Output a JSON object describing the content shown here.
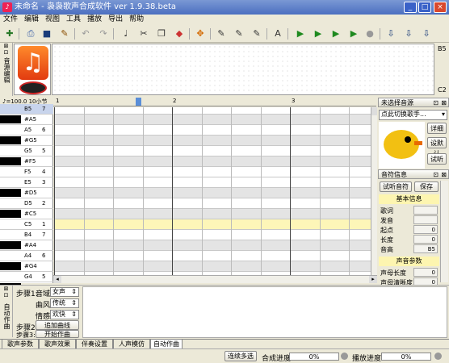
{
  "window": {
    "title": "未命名 - 袅袅歌声合成软件 ver 1.9.38.beta",
    "minimize": "_",
    "maximize": "□",
    "close": "×"
  },
  "menu": [
    "文件",
    "编辑",
    "视图",
    "工具",
    "播放",
    "导出",
    "帮助"
  ],
  "toolbar": {
    "icons": [
      "new-icon",
      "print-icon",
      "save-icon",
      "edit-icon",
      "undo-icon",
      "redo-icon",
      "note-icon",
      "cut-icon",
      "copy-icon",
      "eraser-icon",
      "move-icon",
      "pen-icon",
      "pen2-icon",
      "pen3-icon",
      "text-icon",
      "play-icon",
      "play2-icon",
      "play3-icon",
      "play4-icon",
      "stop-icon",
      "export-icon",
      "export2-icon",
      "export3-icon"
    ]
  },
  "singer_area": {
    "side_label": "音源编辑",
    "right_top": "B5",
    "right_bottom": "C2"
  },
  "ruler": {
    "header": "♪=100.0 10小节",
    "marks": [
      "1",
      "2",
      "3"
    ]
  },
  "piano_keys": [
    {
      "name": "B5",
      "num": "7",
      "black": false,
      "selected": true
    },
    {
      "name": "#A5",
      "num": "",
      "black": true
    },
    {
      "name": "A5",
      "num": "6",
      "black": false
    },
    {
      "name": "#G5",
      "num": "",
      "black": true
    },
    {
      "name": "G5",
      "num": "5",
      "black": false
    },
    {
      "name": "#F5",
      "num": "",
      "black": true
    },
    {
      "name": "F5",
      "num": "4",
      "black": false
    },
    {
      "name": "E5",
      "num": "3",
      "black": false
    },
    {
      "name": "#D5",
      "num": "",
      "black": true
    },
    {
      "name": "D5",
      "num": "2",
      "black": false
    },
    {
      "name": "#C5",
      "num": "",
      "black": true
    },
    {
      "name": "C5",
      "num": "1",
      "black": false,
      "highlight": true
    },
    {
      "name": "B4",
      "num": "7",
      "black": false
    },
    {
      "name": "#A4",
      "num": "",
      "black": true
    },
    {
      "name": "A4",
      "num": "6",
      "black": false
    },
    {
      "name": "#G4",
      "num": "",
      "black": true
    },
    {
      "name": "G4",
      "num": "5",
      "black": false
    },
    {
      "name": "#F4",
      "num": "",
      "black": true
    }
  ],
  "singer_panel": {
    "title": "未选择音源",
    "dropdown": "点此切换歌手...",
    "buttons": [
      "详细",
      "设默认",
      "试听"
    ]
  },
  "note_panel": {
    "title": "音符信息",
    "buttons": [
      "试听音符",
      "保存"
    ],
    "section_basic": "基本信息",
    "fields": [
      {
        "label": "歌词",
        "value": ""
      },
      {
        "label": "发音",
        "value": ""
      },
      {
        "label": "起点",
        "value": "0"
      },
      {
        "label": "长度",
        "value": "0"
      },
      {
        "label": "音高",
        "value": "B5"
      }
    ],
    "section_voice": "声音参数",
    "voice_fields": [
      {
        "label": "声母长度",
        "value": "0"
      },
      {
        "label": "声母清晰度",
        "value": "0"
      }
    ]
  },
  "auto_compose": {
    "side_label": "自动作曲",
    "step1": "步骤1:",
    "step2": "步骤2:",
    "step3": "步骤3:",
    "voice_label": "音域",
    "voice_value": "女声",
    "style_label": "曲风",
    "style_value": "传统",
    "mood_label": "情感",
    "mood_value": "欢快",
    "add_curve": "追加曲线",
    "start_compose": "开始作曲"
  },
  "tabs": [
    "歌声参数",
    "歌声效果",
    "伴奏设置",
    "人声模仿",
    "自动作曲"
  ],
  "status": {
    "multi_select": "连续多选",
    "synth_label": "合成进度",
    "synth_value": "0%",
    "synth_fraction": 0,
    "play_label": "播放进度",
    "play_value": "0%",
    "play_fraction": 0
  }
}
